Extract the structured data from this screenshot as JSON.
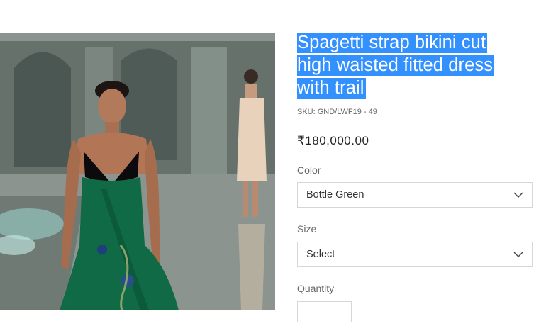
{
  "product": {
    "title_lines": [
      "Spagetti strap bikini cut",
      "high waisted fitted dress",
      "with trail"
    ],
    "sku": "SKU: GND/LWF19 - 49",
    "price": "₹180,000.00",
    "image_alt": "runway-model-green-gown"
  },
  "options": {
    "color": {
      "label": "Color",
      "value": "Bottle Green"
    },
    "size": {
      "label": "Size",
      "value": "Select"
    },
    "quantity": {
      "label": "Quantity"
    }
  },
  "colors": {
    "highlight": "#3390ff",
    "border": "#d6d6d6",
    "label": "#666666",
    "dress_green": "#0f6a45"
  }
}
